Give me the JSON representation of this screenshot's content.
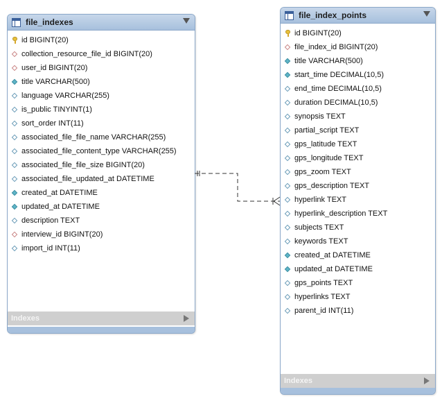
{
  "tables": [
    {
      "title": "file_indexes",
      "footer": "Indexes",
      "columns": [
        {
          "text": "id BIGINT(20)",
          "icon": "key-icon"
        },
        {
          "text": "collection_resource_file_id BIGINT(20)",
          "icon": "foreign-key-diamond-icon"
        },
        {
          "text": "user_id BIGINT(20)",
          "icon": "foreign-key-diamond-icon"
        },
        {
          "text": "title VARCHAR(500)",
          "icon": "filled-diamond-icon"
        },
        {
          "text": "language VARCHAR(255)",
          "icon": "diamond-icon"
        },
        {
          "text": "is_public TINYINT(1)",
          "icon": "diamond-icon"
        },
        {
          "text": "sort_order INT(11)",
          "icon": "diamond-icon"
        },
        {
          "text": "associated_file_file_name VARCHAR(255)",
          "icon": "diamond-icon"
        },
        {
          "text": "associated_file_content_type VARCHAR(255)",
          "icon": "diamond-icon"
        },
        {
          "text": "associated_file_file_size BIGINT(20)",
          "icon": "diamond-icon"
        },
        {
          "text": "associated_file_updated_at DATETIME",
          "icon": "diamond-icon"
        },
        {
          "text": "created_at DATETIME",
          "icon": "filled-diamond-icon"
        },
        {
          "text": "updated_at DATETIME",
          "icon": "filled-diamond-icon"
        },
        {
          "text": "description TEXT",
          "icon": "diamond-icon"
        },
        {
          "text": "interview_id BIGINT(20)",
          "icon": "foreign-key-diamond-icon"
        },
        {
          "text": "import_id INT(11)",
          "icon": "diamond-icon"
        }
      ]
    },
    {
      "title": "file_index_points",
      "footer": "Indexes",
      "columns": [
        {
          "text": "id BIGINT(20)",
          "icon": "key-icon"
        },
        {
          "text": "file_index_id BIGINT(20)",
          "icon": "foreign-key-diamond-icon"
        },
        {
          "text": "title VARCHAR(500)",
          "icon": "filled-diamond-icon"
        },
        {
          "text": "start_time DECIMAL(10,5)",
          "icon": "filled-diamond-icon"
        },
        {
          "text": "end_time DECIMAL(10,5)",
          "icon": "diamond-icon"
        },
        {
          "text": "duration DECIMAL(10,5)",
          "icon": "diamond-icon"
        },
        {
          "text": "synopsis TEXT",
          "icon": "diamond-icon"
        },
        {
          "text": "partial_script TEXT",
          "icon": "diamond-icon"
        },
        {
          "text": "gps_latitude TEXT",
          "icon": "diamond-icon"
        },
        {
          "text": "gps_longitude TEXT",
          "icon": "diamond-icon"
        },
        {
          "text": "gps_zoom TEXT",
          "icon": "diamond-icon"
        },
        {
          "text": "gps_description TEXT",
          "icon": "diamond-icon"
        },
        {
          "text": "hyperlink TEXT",
          "icon": "diamond-icon"
        },
        {
          "text": "hyperlink_description TEXT",
          "icon": "diamond-icon"
        },
        {
          "text": "subjects TEXT",
          "icon": "diamond-icon"
        },
        {
          "text": "keywords TEXT",
          "icon": "diamond-icon"
        },
        {
          "text": "created_at DATETIME",
          "icon": "filled-diamond-icon"
        },
        {
          "text": "updated_at DATETIME",
          "icon": "filled-diamond-icon"
        },
        {
          "text": "gps_points TEXT",
          "icon": "diamond-icon"
        },
        {
          "text": "hyperlinks TEXT",
          "icon": "diamond-icon"
        },
        {
          "text": "parent_id INT(11)",
          "icon": "diamond-icon"
        }
      ]
    }
  ],
  "colors": {
    "header": "#a7c0dd",
    "border": "#8aa7c9",
    "filled_diamond": "#5fb5c7",
    "fk_diamond": "#c98585",
    "key": "#e8c13a"
  }
}
